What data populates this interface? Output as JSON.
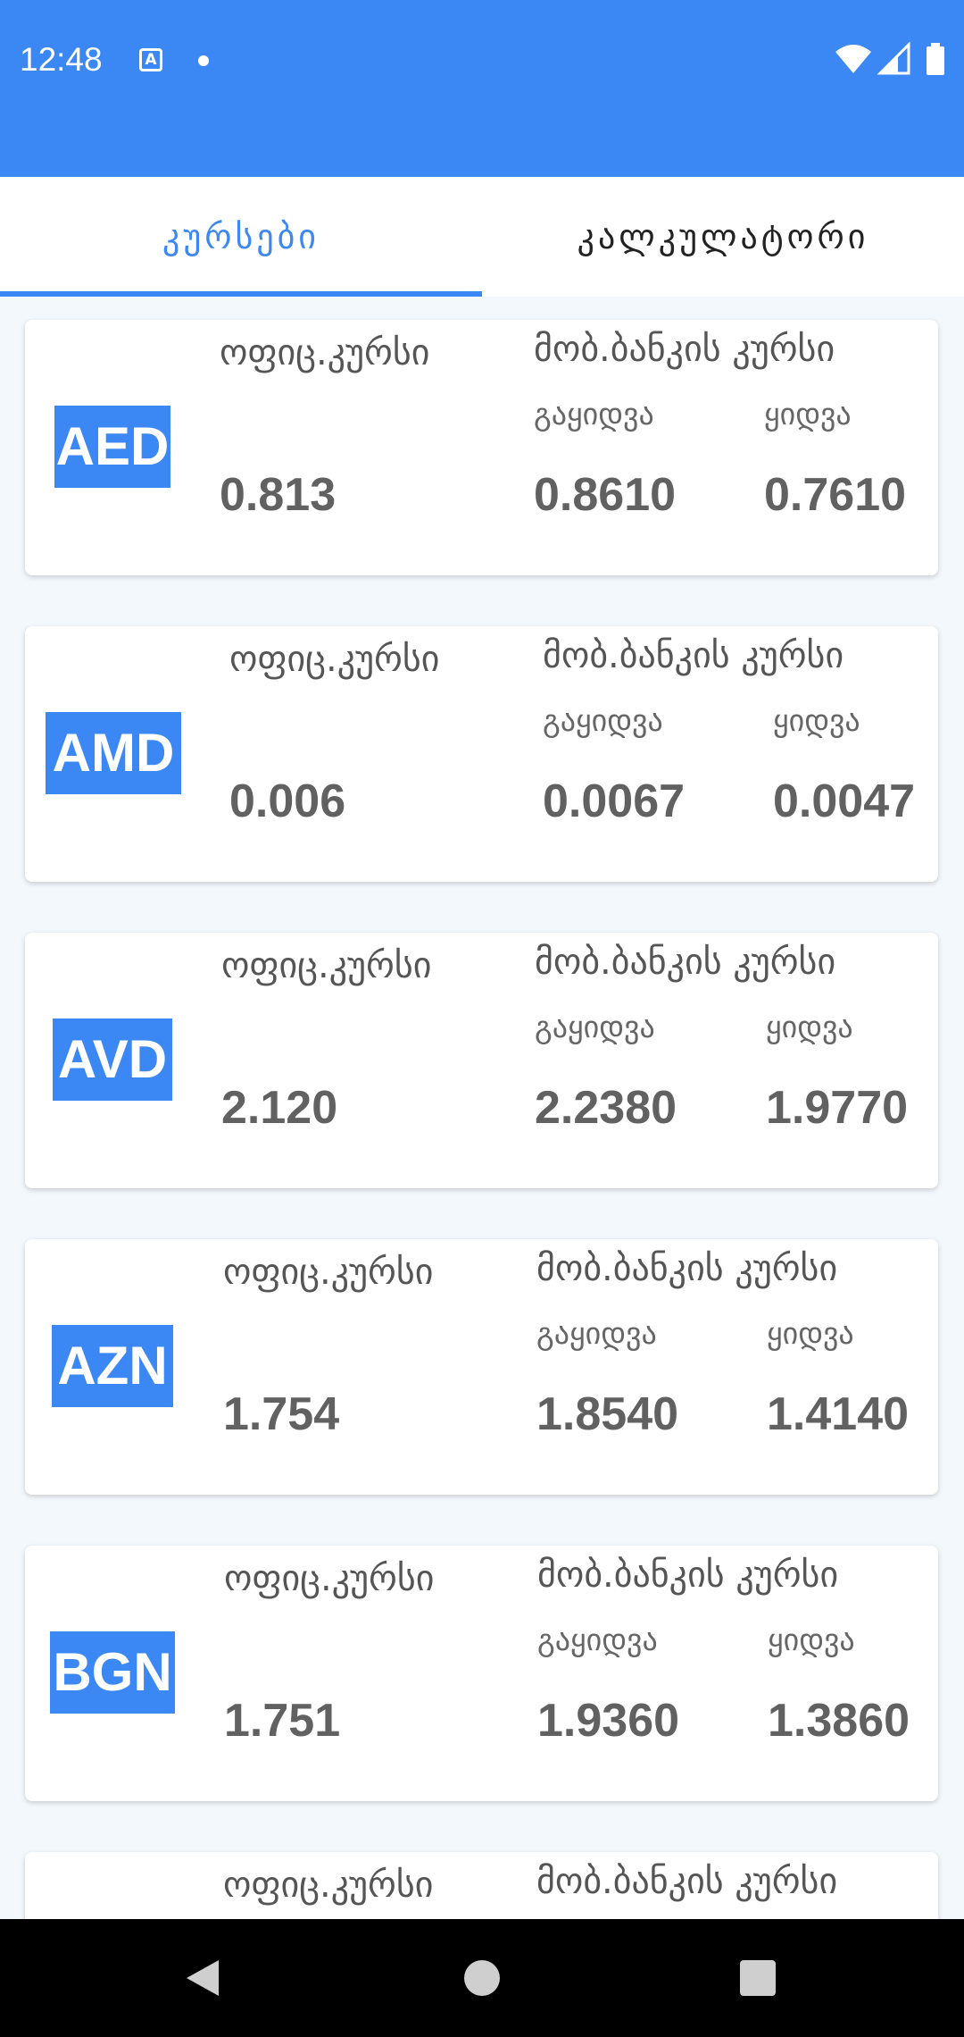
{
  "status": {
    "time": "12:48"
  },
  "tabs": [
    {
      "label": "კურსები"
    },
    {
      "label": "კალკულატორი"
    }
  ],
  "labels": {
    "official": "ოფიც.კურსი",
    "bank": "მობ.ბანკის კურსი",
    "sell": "გაყიდვა",
    "buy": "ყიდვა"
  },
  "rates": [
    {
      "code": "AED",
      "official": "0.813",
      "sell": "0.8610",
      "buy": "0.7610"
    },
    {
      "code": "AMD",
      "official": "0.006",
      "sell": "0.0067",
      "buy": "0.0047"
    },
    {
      "code": "AVD",
      "official": "2.120",
      "sell": "2.2380",
      "buy": "1.9770"
    },
    {
      "code": "AZN",
      "official": "1.754",
      "sell": "1.8540",
      "buy": "1.4140"
    },
    {
      "code": "BGN",
      "official": "1.751",
      "sell": "1.9360",
      "buy": "1.3860"
    }
  ],
  "colors": {
    "accent": "#3B88F5",
    "background": "#F3F8FC",
    "value_text": "#616161"
  }
}
